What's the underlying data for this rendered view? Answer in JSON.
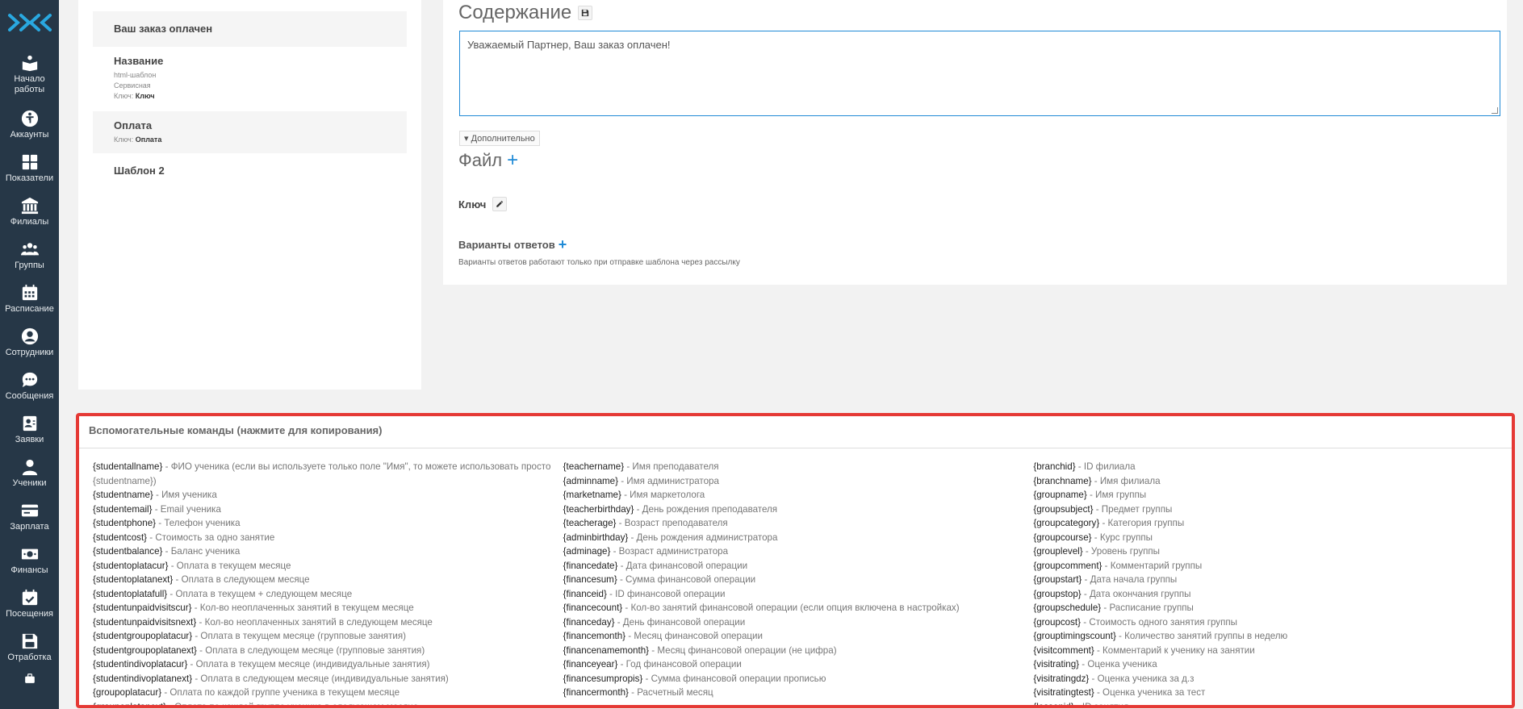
{
  "sidebar": {
    "logo": "ЖК",
    "items": [
      {
        "label": "Начало работы",
        "icon": "book-icon"
      },
      {
        "label": "Аккаунты",
        "icon": "accessibility-icon"
      },
      {
        "label": "Показатели",
        "icon": "grid-icon"
      },
      {
        "label": "Филиалы",
        "icon": "bank-icon"
      },
      {
        "label": "Группы",
        "icon": "group-icon"
      },
      {
        "label": "Расписание",
        "icon": "calendar-icon"
      },
      {
        "label": "Сотрудники",
        "icon": "user-circle-icon"
      },
      {
        "label": "Сообщения",
        "icon": "chat-icon"
      },
      {
        "label": "Заявки",
        "icon": "contact-card-icon"
      },
      {
        "label": "Ученики",
        "icon": "person-icon"
      },
      {
        "label": "Зарплата",
        "icon": "credit-card-icon"
      },
      {
        "label": "Финансы",
        "icon": "money-icon"
      },
      {
        "label": "Посещения",
        "icon": "calendar-check-icon"
      },
      {
        "label": "Отработка",
        "icon": "save-icon"
      }
    ]
  },
  "templates": [
    {
      "title": "Ваш заказ оплачен",
      "lines": []
    },
    {
      "title": "Название",
      "lines": [
        "html-шаблон",
        "Сервисная"
      ],
      "key_label": "Ключ:",
      "key_value": "Ключ"
    },
    {
      "title": "Оплата",
      "lines": [],
      "key_label": "Ключ:",
      "key_value": "Оплата"
    },
    {
      "title": "Шаблон 2",
      "lines": []
    }
  ],
  "editor": {
    "content_heading": "Содержание",
    "content_text": "Уважаемый Партнер, Ваш заказ оплачен!",
    "more_label": "▾ Дополнительно",
    "file_heading": "Файл",
    "key_label": "Ключ",
    "answers_label": "Варианты ответов",
    "answers_note": "Варианты ответов работают только при отправке шаблона через рассылку"
  },
  "helper": {
    "title": "Вспомогательные команды (нажмите для копирования)",
    "columns": [
      [
        {
          "cmd": "{studentallname}",
          "desc": " - ФИО ученика (если вы используете только поле \"Имя\", то можете использовать просто {studentname})"
        },
        {
          "cmd": "{studentname}",
          "desc": " - Имя ученика"
        },
        {
          "cmd": "{studentemail}",
          "desc": " - Email ученика"
        },
        {
          "cmd": "{studentphone}",
          "desc": " - Телефон ученика"
        },
        {
          "cmd": "{studentcost}",
          "desc": " - Стоимость за одно занятие"
        },
        {
          "cmd": "{studentbalance}",
          "desc": " - Баланс ученика"
        },
        {
          "cmd": "{studentoplatacur}",
          "desc": " - Оплата в текущем месяце"
        },
        {
          "cmd": "{studentoplatanext}",
          "desc": " - Оплата в следующем месяце"
        },
        {
          "cmd": "{studentoplatafull}",
          "desc": " - Оплата в текущем + следующем месяце"
        },
        {
          "cmd": "{studentunpaidvisitscur}",
          "desc": " - Кол-во неоплаченных занятий в текущем месяце"
        },
        {
          "cmd": "{studentunpaidvisitsnext}",
          "desc": " - Кол-во неоплаченных занятий в следующем месяце"
        },
        {
          "cmd": "{studentgroupoplatacur}",
          "desc": " - Оплата в текущем месяце (групповые занятия)"
        },
        {
          "cmd": "{studentgroupoplatanext}",
          "desc": " - Оплата в следующем месяце (групповые занятия)"
        },
        {
          "cmd": "{studentindivoplatacur}",
          "desc": " - Оплата в текущем месяце (индивидуальные занятия)"
        },
        {
          "cmd": "{studentindivoplatanext}",
          "desc": " - Оплата в следующем месяце (индивидуальные занятия)"
        },
        {
          "cmd": "{groupoplatacur}",
          "desc": " - Оплата по каждой группе ученика в текущем месяце"
        },
        {
          "cmd": "{groupoplatanext}",
          "desc": " - Оплата по каждой группе ученика в следующем месяце"
        }
      ],
      [
        {
          "cmd": "{teachername}",
          "desc": " - Имя преподавателя"
        },
        {
          "cmd": "{adminname}",
          "desc": " - Имя администратора"
        },
        {
          "cmd": "{marketname}",
          "desc": " - Имя маркетолога"
        },
        {
          "cmd": "{teacherbirthday}",
          "desc": " - День рождения преподавателя"
        },
        {
          "cmd": "{teacherage}",
          "desc": " - Возраст преподавателя"
        },
        {
          "cmd": "{adminbirthday}",
          "desc": " - День рождения администратора"
        },
        {
          "cmd": "{adminage}",
          "desc": " - Возраст администратора"
        },
        {
          "cmd": "{financedate}",
          "desc": " - Дата финансовой операции"
        },
        {
          "cmd": "{financesum}",
          "desc": " - Сумма финансовой операции"
        },
        {
          "cmd": "{financeid}",
          "desc": " - ID финансовой операции"
        },
        {
          "cmd": "{financecount}",
          "desc": " - Кол-во занятий финансовой операции (если опция включена в настройках)"
        },
        {
          "cmd": "{financeday}",
          "desc": " - День финансовой операции"
        },
        {
          "cmd": "{financemonth}",
          "desc": " - Месяц финансовой операции"
        },
        {
          "cmd": "{financenamemonth}",
          "desc": " - Месяц финансовой операции (не цифра)"
        },
        {
          "cmd": "{financeyear}",
          "desc": " - Год финансовой операции"
        },
        {
          "cmd": "{financesumpropis}",
          "desc": " - Сумма финансовой операции прописью"
        },
        {
          "cmd": "{financermonth}",
          "desc": " - Расчетный месяц"
        }
      ],
      [
        {
          "cmd": "{branchid}",
          "desc": " - ID филиала"
        },
        {
          "cmd": "{branchname}",
          "desc": " - Имя филиала"
        },
        {
          "cmd": "{groupname}",
          "desc": " - Имя группы"
        },
        {
          "cmd": "{groupsubject}",
          "desc": " - Предмет группы"
        },
        {
          "cmd": "{groupcategory}",
          "desc": " - Категория группы"
        },
        {
          "cmd": "{groupcourse}",
          "desc": " - Курс группы"
        },
        {
          "cmd": "{grouplevel}",
          "desc": " - Уровень группы"
        },
        {
          "cmd": "{groupcomment}",
          "desc": " - Комментарий группы"
        },
        {
          "cmd": "{groupstart}",
          "desc": " - Дата начала группы"
        },
        {
          "cmd": "{groupstop}",
          "desc": " - Дата окончания группы"
        },
        {
          "cmd": "{groupschedule}",
          "desc": " - Расписание группы"
        },
        {
          "cmd": "{groupcost}",
          "desc": " - Стоимость одного занятия группы"
        },
        {
          "cmd": "{grouptimingscount}",
          "desc": " - Количество занятий группы в неделю"
        },
        {
          "cmd": "{visitcomment}",
          "desc": " - Комментарий к ученику на занятии"
        },
        {
          "cmd": "{visitrating}",
          "desc": " - Оценка ученика"
        },
        {
          "cmd": "{visitratingdz}",
          "desc": " - Оценка ученика за д.з"
        },
        {
          "cmd": "{visitratingtest}",
          "desc": " - Оценка ученика за тест"
        },
        {
          "cmd": "{lessonid}",
          "desc": " - ID занятия"
        }
      ]
    ]
  },
  "colors": {
    "sidebar": "#263747",
    "accent": "#1f8ad6",
    "highlight_border": "#e53935"
  }
}
